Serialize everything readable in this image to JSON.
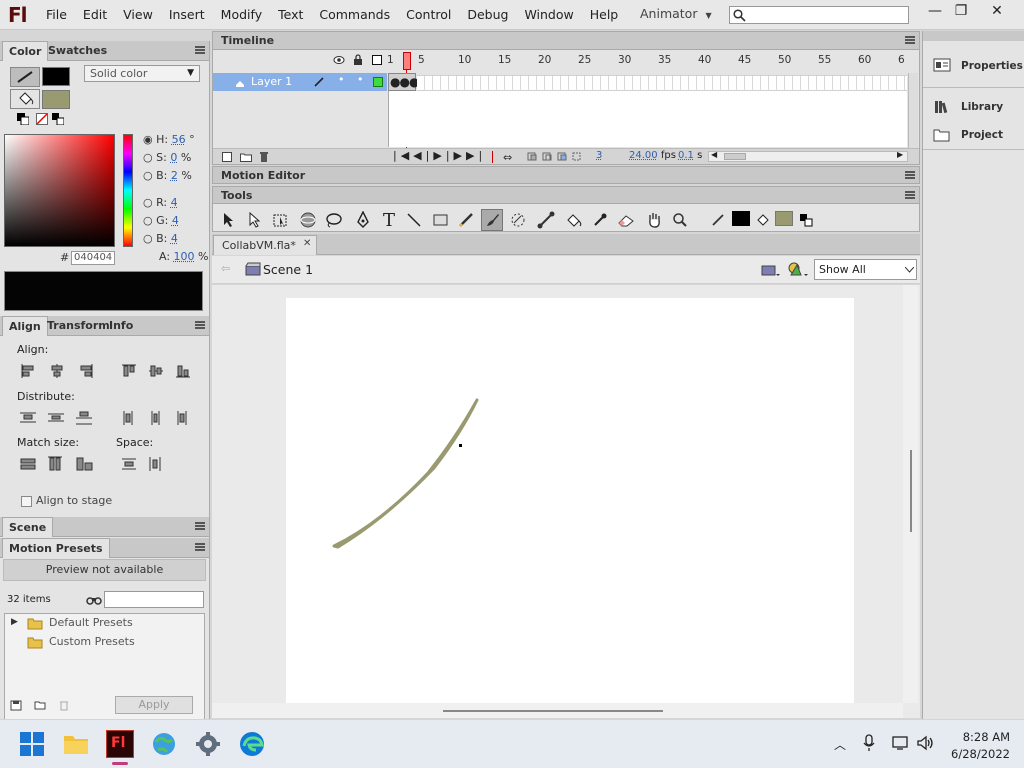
{
  "app": {
    "logo": "Fl",
    "menus": [
      "File",
      "Edit",
      "View",
      "Insert",
      "Modify",
      "Text",
      "Commands",
      "Control",
      "Debug",
      "Window",
      "Help"
    ],
    "workspace": "Animator",
    "window_buttons": [
      "minimize-icon",
      "restore-icon",
      "close-icon"
    ]
  },
  "color_panel": {
    "tabs": [
      "Color",
      "Swatches"
    ],
    "fill_type": "Solid color",
    "hsb": {
      "h_label": "H:",
      "h": "56",
      "h_unit": "°",
      "s_label": "S:",
      "s": "0",
      "s_unit": "%",
      "b_label": "B:",
      "b": "2",
      "b_unit": "%"
    },
    "rgb": {
      "r_label": "R:",
      "r": "4",
      "g_label": "G:",
      "g": "4",
      "b_label": "B:",
      "b": "4"
    },
    "hex_label": "#",
    "hex": "040404",
    "alpha_label": "A:",
    "alpha": "100",
    "alpha_unit": "%",
    "stroke_color": "#000000",
    "fill_color": "#9a9a70"
  },
  "align_panel": {
    "tabs": [
      "Align",
      "Transform",
      "Info"
    ],
    "align_label": "Align:",
    "distribute_label": "Distribute:",
    "match_size_label": "Match size:",
    "space_label": "Space:",
    "align_to_stage": "Align to stage"
  },
  "scene_panel": {
    "title": "Scene"
  },
  "motion_presets": {
    "title": "Motion Presets",
    "preview": "Preview not available",
    "count": "32 items",
    "search_placeholder": "",
    "folders": [
      "Default Presets",
      "Custom Presets"
    ],
    "apply": "Apply"
  },
  "timeline": {
    "title": "Timeline",
    "layer": "Layer 1",
    "ruler": [
      "1",
      "5",
      "10",
      "15",
      "20",
      "25",
      "30",
      "35",
      "40",
      "45",
      "50",
      "55",
      "60",
      "6"
    ],
    "current_frame": "3",
    "fps": "24.00",
    "fps_unit": "fps",
    "time": "0.1",
    "time_unit": "s"
  },
  "motion_editor": {
    "title": "Motion Editor"
  },
  "tools_panel": {
    "title": "Tools"
  },
  "document": {
    "tab": "CollabVM.fla*",
    "scene": "Scene 1",
    "zoom": "Show All",
    "stroke_color": "#9a9a70"
  },
  "right_panels": [
    "Properties",
    "Library",
    "Project"
  ],
  "taskbar": {
    "time": "8:28 AM",
    "date": "6/28/2022"
  }
}
